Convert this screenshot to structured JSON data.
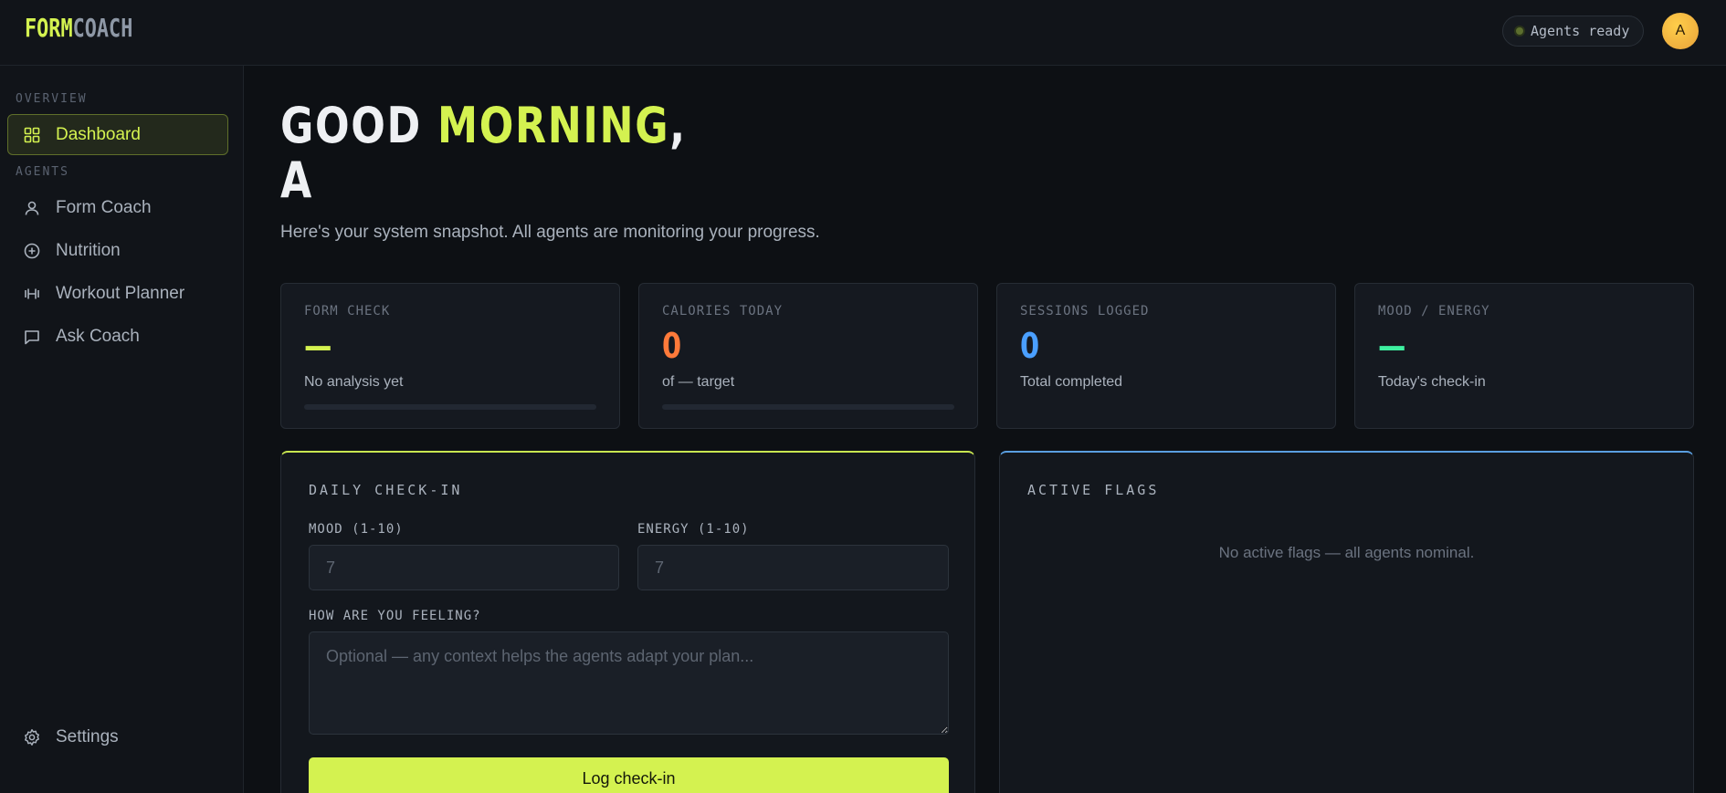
{
  "header": {
    "logo_part1": "FORM",
    "logo_part2": "COACH",
    "status": "Agents ready",
    "avatar_initial": "A"
  },
  "sidebar": {
    "overview_label": "OVERVIEW",
    "agents_label": "AGENTS",
    "items": [
      {
        "label": "Dashboard",
        "icon": "grid-icon",
        "active": true
      },
      {
        "label": "Form Coach",
        "icon": "user-icon"
      },
      {
        "label": "Nutrition",
        "icon": "plus-circle-icon"
      },
      {
        "label": "Workout Planner",
        "icon": "dumbbell-icon"
      },
      {
        "label": "Ask Coach",
        "icon": "chat-icon"
      }
    ],
    "settings_label": "Settings"
  },
  "main": {
    "greeting_prefix": "GOOD ",
    "greeting_accent": "MORNING",
    "greeting_suffix": ",",
    "greeting_name": "A",
    "subtitle": "Here's your system snapshot. All agents are monitoring your progress.",
    "stats": [
      {
        "label": "FORM CHECK",
        "value": "—",
        "sub": "No analysis yet",
        "color": "#d4f250",
        "progress": 0
      },
      {
        "label": "CALORIES TODAY",
        "value": "0",
        "sub": "of — target",
        "color": "#ff7a3a",
        "progress": 0
      },
      {
        "label": "SESSIONS LOGGED",
        "value": "0",
        "sub": "Total completed",
        "color": "#4a9fff"
      },
      {
        "label": "MOOD / ENERGY",
        "value": "—",
        "sub": "Today's check-in",
        "color": "#3ef0a0"
      }
    ],
    "checkin": {
      "title": "DAILY CHECK-IN",
      "mood_label": "MOOD (1-10)",
      "mood_placeholder": "7",
      "energy_label": "ENERGY (1-10)",
      "energy_placeholder": "7",
      "feeling_label": "HOW ARE YOU FEELING?",
      "feeling_placeholder": "Optional — any context helps the agents adapt your plan...",
      "button_label": "Log check-in"
    },
    "flags": {
      "title": "ACTIVE FLAGS",
      "empty_text": "No active flags — all agents nominal."
    }
  }
}
